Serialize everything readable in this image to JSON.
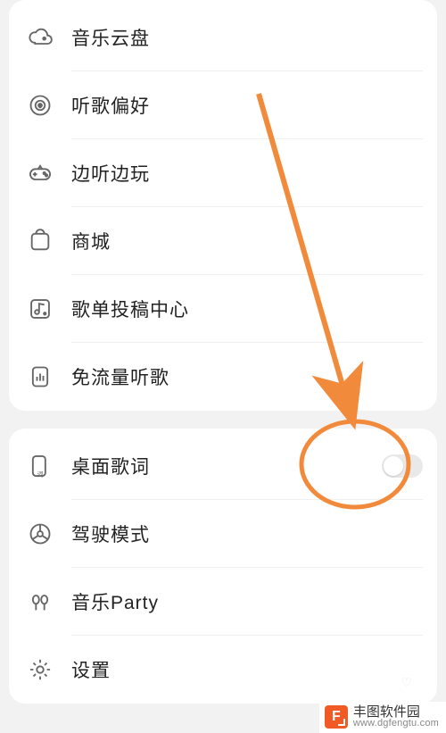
{
  "group1": {
    "items": [
      {
        "icon": "cloud-disk-icon",
        "label": "音乐云盘"
      },
      {
        "icon": "preference-icon",
        "label": "听歌偏好"
      },
      {
        "icon": "gamepad-icon",
        "label": "边听边玩"
      },
      {
        "icon": "store-icon",
        "label": "商城"
      },
      {
        "icon": "playlist-sub-icon",
        "label": "歌单投稿中心"
      },
      {
        "icon": "free-data-icon",
        "label": "免流量听歌"
      }
    ]
  },
  "group2": {
    "items": [
      {
        "icon": "lyrics-icon",
        "label": "桌面歌词",
        "toggle": false
      },
      {
        "icon": "driving-icon",
        "label": "驾驶模式"
      },
      {
        "icon": "party-icon",
        "label": "音乐Party"
      },
      {
        "icon": "settings-icon",
        "label": "设置"
      }
    ]
  },
  "annotation": {
    "target": "desktop-lyrics-toggle",
    "color": "#f28a3c"
  },
  "watermark": {
    "badge": "F",
    "title": "丰图软件园",
    "url": "www.dgfengtu.com"
  }
}
